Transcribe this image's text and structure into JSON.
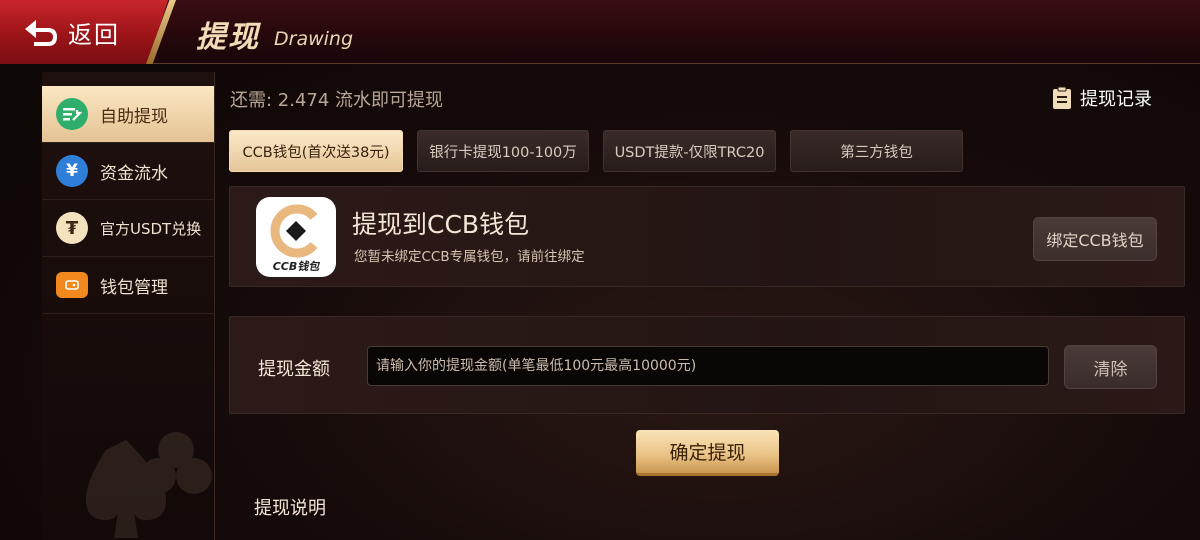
{
  "header": {
    "back_label": "返回",
    "title_cn": "提现",
    "title_en": "Drawing"
  },
  "sidebar": {
    "items": [
      {
        "label": "自助提现",
        "icon": "withdraw-arrow-icon",
        "active": true
      },
      {
        "label": "资金流水",
        "icon": "yen-coin-icon",
        "active": false
      },
      {
        "label": "官方USDT兑换",
        "icon": "usdt-coin-icon",
        "active": false
      },
      {
        "label": "钱包管理",
        "icon": "wallet-icon",
        "active": false
      }
    ]
  },
  "main": {
    "notice": "还需: 2.474 流水即可提现",
    "records_label": "提现记录",
    "tabs": [
      {
        "label": "CCB钱包(首次送38元)",
        "active": true
      },
      {
        "label": "银行卡提现100-100万",
        "active": false
      },
      {
        "label": "USDT提款-仅限TRC20",
        "active": false
      },
      {
        "label": "第三方钱包",
        "active": false
      }
    ],
    "wallet_card": {
      "logo_text": "CCB钱包",
      "title": "提现到CCB钱包",
      "subtitle": "您暂未绑定CCB专属钱包，请前往绑定",
      "bind_label": "绑定CCB钱包"
    },
    "amount": {
      "label": "提现金额",
      "placeholder": "请输入你的提现金额(单笔最低100元最高10000元)",
      "value": "",
      "clear_label": "清除"
    },
    "confirm_label": "确定提现",
    "instructions_label": "提现说明"
  },
  "colors": {
    "accent_gold": "#e9c184",
    "header_red": "#c8262c",
    "background": "#160b0a"
  }
}
